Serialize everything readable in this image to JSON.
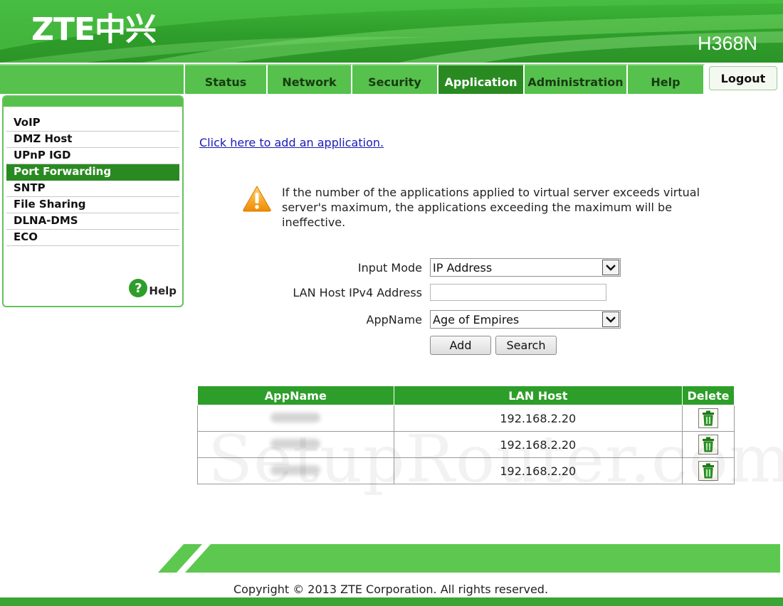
{
  "header": {
    "logo_text": "ZTE中兴",
    "model": "H368N"
  },
  "nav": {
    "tabs": [
      {
        "label": "Status"
      },
      {
        "label": "Network"
      },
      {
        "label": "Security"
      },
      {
        "label": "Application",
        "active": true
      },
      {
        "label": "Administration"
      },
      {
        "label": "Help"
      }
    ],
    "logout_label": "Logout"
  },
  "sidebar": {
    "items": [
      {
        "label": "VoIP"
      },
      {
        "label": "DMZ Host"
      },
      {
        "label": "UPnP IGD"
      },
      {
        "label": "Port Forwarding",
        "active": true
      },
      {
        "label": "SNTP"
      },
      {
        "label": "File Sharing"
      },
      {
        "label": "DLNA-DMS"
      },
      {
        "label": "ECO"
      }
    ],
    "help_icon_glyph": "?",
    "help_label": "Help"
  },
  "main": {
    "add_link": "Click here to add an application.",
    "warning_text": "If the number of the applications applied to virtual server exceeds virtual server's maximum, the applications exceeding the maximum will be ineffective.",
    "form": {
      "input_mode_label": "Input Mode",
      "input_mode_value": "IP Address",
      "lan_host_label": "LAN Host IPv4 Address",
      "lan_host_value": "",
      "appname_label": "AppName",
      "appname_value": "Age of Empires",
      "add_button": "Add",
      "search_button": "Search"
    },
    "table": {
      "headers": [
        "AppName",
        "LAN Host",
        "Delete"
      ],
      "rows": [
        {
          "appname": "",
          "lan_host": "192.168.2.20"
        },
        {
          "appname": "",
          "lan_host": "192.168.2.20"
        },
        {
          "appname": "",
          "lan_host": "192.168.2.20"
        }
      ]
    }
  },
  "watermark": "SetupRouter.com",
  "footer": {
    "copyright": "Copyright © 2013 ZTE Corporation. All rights reserved."
  },
  "colors": {
    "brand_green": "#2e9e2a",
    "tab_green": "#56c14c",
    "active_green": "#2a8a22",
    "link_blue": "#1a1ab8"
  }
}
